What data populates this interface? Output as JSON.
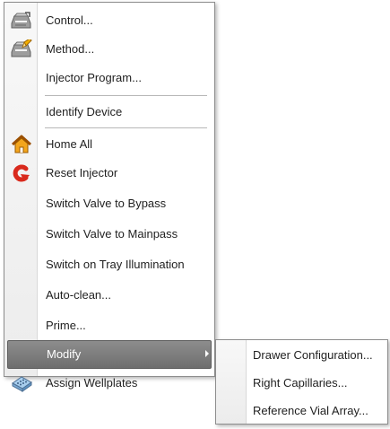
{
  "menu": {
    "items": [
      {
        "label": "Control...",
        "icon": "control-device-icon"
      },
      {
        "label": "Method...",
        "icon": "method-device-icon"
      },
      {
        "label": "Injector Program...",
        "icon": ""
      },
      {
        "label": "Identify Device",
        "icon": ""
      },
      {
        "label": "Home All",
        "icon": "home-icon"
      },
      {
        "label": "Reset Injector",
        "icon": "reset-arrow-icon"
      },
      {
        "label": "Switch Valve to Bypass",
        "icon": ""
      },
      {
        "label": "Switch Valve to Mainpass",
        "icon": ""
      },
      {
        "label": "Switch on Tray Illumination",
        "icon": ""
      },
      {
        "label": "Auto-clean...",
        "icon": ""
      },
      {
        "label": "Prime...",
        "icon": ""
      },
      {
        "label": "Modify",
        "icon": "",
        "selected": true,
        "has_submenu": true
      },
      {
        "label": "Assign Wellplates",
        "icon": "wellplate-icon"
      }
    ]
  },
  "submenu": {
    "items": [
      {
        "label": "Drawer Configuration..."
      },
      {
        "label": "Right Capillaries..."
      },
      {
        "label": "Reference Vial Array..."
      }
    ]
  },
  "colors": {
    "selected_background": "#7f7f7f",
    "menu_text": "#1f1f1f",
    "selected_text": "#ffffff",
    "home_icon": "#f3a51c",
    "reset_icon": "#d92a1d",
    "wellplate_icon": "#5d93c3"
  }
}
